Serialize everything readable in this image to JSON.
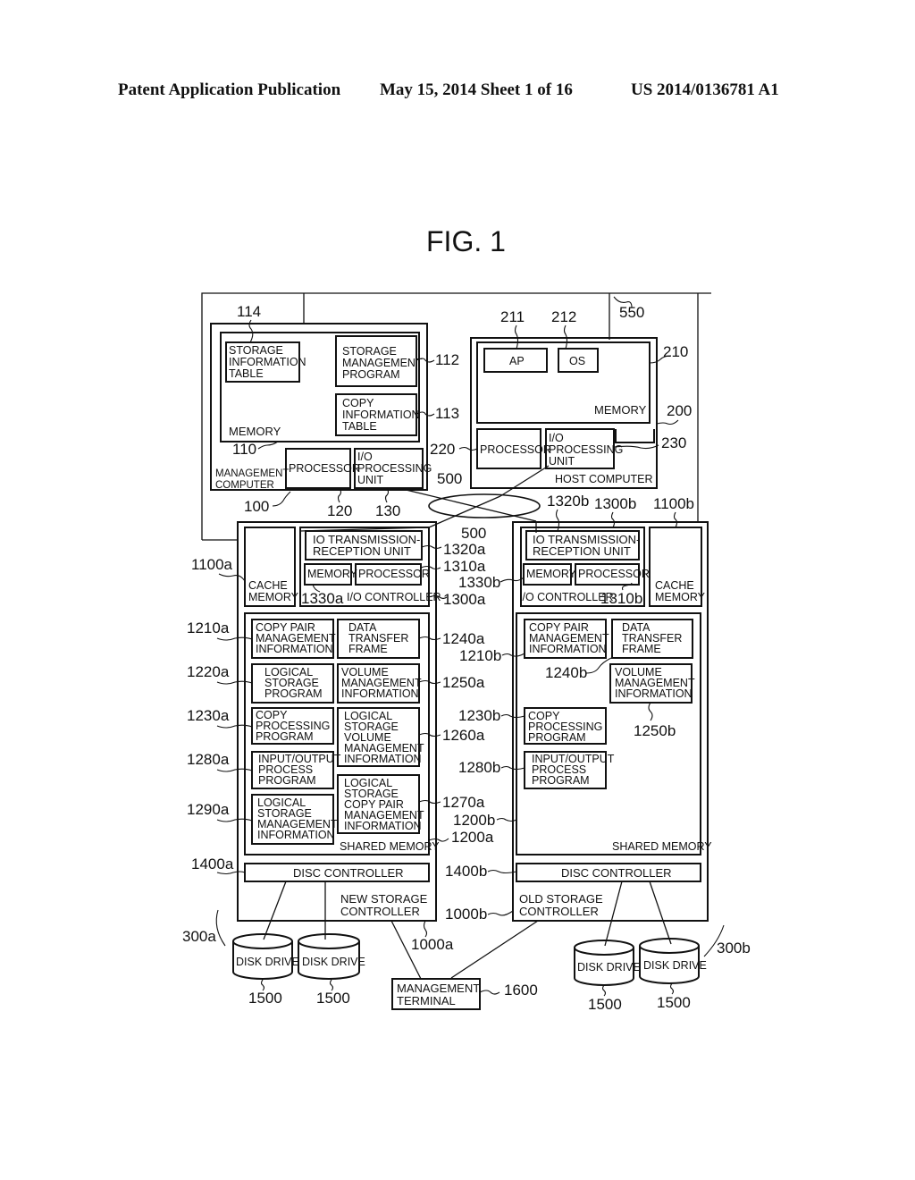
{
  "header": {
    "left": "Patent Application Publication",
    "middle": "May 15, 2014  Sheet 1 of 16",
    "right": "US 2014/0136781 A1"
  },
  "figure": {
    "title": "FIG. 1",
    "network": {
      "ref": "550",
      "san_ref": "500"
    },
    "management_computer": {
      "ref": "100",
      "label": [
        "MANAGEMENT",
        "COMPUTER"
      ],
      "memory": {
        "ref": "110",
        "label": "MEMORY"
      },
      "storage_information_table": {
        "ref": "114",
        "label": [
          "STORAGE",
          "INFORMATION",
          "TABLE"
        ]
      },
      "storage_management_program": {
        "ref": "112",
        "label": [
          "STORAGE",
          "MANAGEMENT",
          "PROGRAM"
        ]
      },
      "copy_information_table": {
        "ref": "113",
        "label": [
          "COPY",
          "INFORMATION",
          "TABLE"
        ]
      },
      "processor": {
        "ref": "120",
        "label": "PROCESSOR"
      },
      "io_unit": {
        "ref": "130",
        "label": [
          "I/O",
          "PROCESSING",
          "UNIT"
        ]
      }
    },
    "host_computer": {
      "ref": "200",
      "label": "HOST COMPUTER",
      "memory": {
        "ref": "210",
        "label": "MEMORY"
      },
      "ap": {
        "ref": "211",
        "label": "AP"
      },
      "os": {
        "ref": "212",
        "label": "OS"
      },
      "processor": {
        "ref": "220",
        "label": "PROCESSOR"
      },
      "io_unit": {
        "ref": "230",
        "label": [
          "I/O",
          "PROCESSING",
          "UNIT"
        ]
      }
    },
    "new_storage": {
      "ref": "1000a",
      "label": [
        "NEW STORAGE",
        "CONTROLLER"
      ],
      "cache": {
        "ref": "1100a",
        "label": [
          "CACHE",
          "MEMORY"
        ]
      },
      "io_controller": {
        "ref": "1300a",
        "label": "I/O CONTROLLER"
      },
      "io_tx": {
        "ref": "1320a",
        "label": [
          "IO TRANSMISSION-",
          "RECEPTION UNIT"
        ]
      },
      "memory": {
        "ref": "1330a",
        "label": "MEMORY"
      },
      "processor": {
        "ref": "1310a",
        "label": "PROCESSOR"
      },
      "shared_memory": {
        "ref": "1200a",
        "label": "SHARED MEMORY"
      },
      "items": [
        {
          "ref": "1210a",
          "label": [
            "COPY PAIR",
            "MANAGEMENT",
            "INFORMATION"
          ]
        },
        {
          "ref": "1220a",
          "label": [
            "LOGICAL",
            "STORAGE",
            "PROGRAM"
          ]
        },
        {
          "ref": "1230a",
          "label": [
            "COPY",
            "PROCESSING",
            "PROGRAM"
          ]
        },
        {
          "ref": "1280a",
          "label": [
            "INPUT/OUTPUT",
            "PROCESS",
            "PROGRAM"
          ]
        },
        {
          "ref": "1290a",
          "label": [
            "LOGICAL",
            "STORAGE",
            "MANAGEMENT",
            "INFORMATION"
          ]
        },
        {
          "ref": "1240a",
          "label": [
            "DATA",
            "TRANSFER",
            "FRAME"
          ]
        },
        {
          "ref": "1250a",
          "label": [
            "VOLUME",
            "MANAGEMENT",
            "INFORMATION"
          ]
        },
        {
          "ref": "1260a",
          "label": [
            "LOGICAL",
            "STORAGE",
            "VOLUME",
            "MANAGEMENT",
            "INFORMATION"
          ]
        },
        {
          "ref": "1270a",
          "label": [
            "LOGICAL",
            "STORAGE",
            "COPY PAIR",
            "MANAGEMENT",
            "INFORMATION"
          ]
        }
      ],
      "disc_controller": {
        "ref": "1400a",
        "label": "DISC CONTROLLER"
      },
      "disk_group": {
        "ref": "300a"
      }
    },
    "old_storage": {
      "ref": "1000b",
      "label": [
        "OLD STORAGE",
        "CONTROLLER"
      ],
      "cache": {
        "ref": "1100b",
        "label": [
          "CACHE",
          "MEMORY"
        ]
      },
      "io_controller": {
        "ref": "1300b",
        "label": "I/O CONTROLLER"
      },
      "io_tx": {
        "ref": "1320b",
        "label": [
          "IO TRANSMISSION-",
          "RECEPTION UNIT"
        ]
      },
      "memory": {
        "ref": "1330b",
        "label": "MEMORY"
      },
      "processor": {
        "ref": "1310b",
        "label": "PROCESSOR"
      },
      "shared_memory": {
        "ref": "1200b",
        "label": "SHARED MEMORY"
      },
      "items": [
        {
          "ref": "1210b",
          "label": [
            "COPY PAIR",
            "MANAGEMENT",
            "INFORMATION"
          ]
        },
        {
          "ref": "1240b",
          "label": [
            "DATA",
            "TRANSFER",
            "FRAME"
          ]
        },
        {
          "ref": "1250b",
          "label": [
            "VOLUME",
            "MANAGEMENT",
            "INFORMATION"
          ]
        },
        {
          "ref": "1230b",
          "label": [
            "COPY",
            "PROCESSING",
            "PROGRAM"
          ]
        },
        {
          "ref": "1280b",
          "label": [
            "INPUT/OUTPUT",
            "PROCESS",
            "PROGRAM"
          ]
        }
      ],
      "disc_controller": {
        "ref": "1400b",
        "label": "DISC CONTROLLER"
      },
      "disk_group": {
        "ref": "300b"
      }
    },
    "disk_drive": {
      "ref": "1500",
      "label": "DISK DRIVE"
    },
    "management_terminal": {
      "ref": "1600",
      "label": [
        "MANAGEMENT",
        "TERMINAL"
      ]
    }
  }
}
